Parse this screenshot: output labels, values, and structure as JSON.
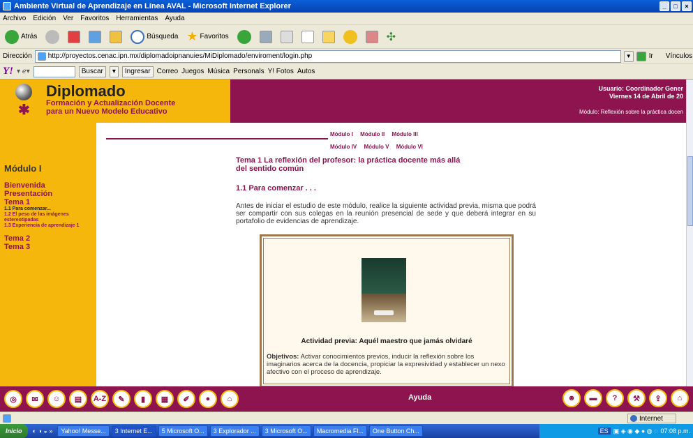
{
  "window": {
    "title": "Ambiente Virtual de Aprendizaje en Línea AVAL - Microsoft Internet Explorer"
  },
  "menu": [
    "Archivo",
    "Edición",
    "Ver",
    "Favoritos",
    "Herramientas",
    "Ayuda"
  ],
  "toolbar": {
    "back": "Atrás",
    "search": "Búsqueda",
    "favorites": "Favoritos"
  },
  "address": {
    "label": "Dirección",
    "url": "http://proyectos.cenac.ipn.mx/diplomadoipnanuies/MiDiplomado/enviroment/login.php",
    "go": "Ir",
    "links": "Vínculos"
  },
  "yahoo": {
    "search_btn": "Buscar",
    "ingresar": "Ingresar",
    "correo": "Correo",
    "juegos": "Juegos",
    "musica": "Música",
    "personals": "Personals",
    "fotos": "Y! Fotos",
    "autos": "Autos"
  },
  "header": {
    "title": "Diplomado",
    "sub1": "Formación y Actualización Docente",
    "sub2": "para un Nuevo Modelo Educativo",
    "user": "Usuario: Coordinador Gener",
    "date": "Viernes 14 de Abril de 20",
    "module": "Módulo: Reflexión sobre la práctica docen"
  },
  "sidebar": {
    "title": "Módulo I",
    "links": [
      "Bienvenida",
      "Presentación",
      "Tema 1"
    ],
    "sublinks": [
      "1.1 Para comenzar...",
      "1.2 El peso de las imágenes estereotipadas",
      "1.3 Experiencia de aprendizaje 1"
    ],
    "links2": [
      "Tema 2",
      "Tema 3"
    ]
  },
  "modnav": {
    "row1": [
      "Módulo I",
      "Módulo II",
      "Módulo III"
    ],
    "row2": [
      "Módulo IV",
      "Módulo V",
      "Módulo VI"
    ]
  },
  "content": {
    "tema_title": "Tema 1 La reflexión del profesor: la práctica docente más allá del sentido común",
    "section": "1.1 Para comenzar . . .",
    "intro": "Antes de iniciar el estudio de este módulo, realice la siguiente actividad previa, misma que podrá ser compartir con sus colegas en la reunión presencial de sede y que deberá integrar en su portafolio de evidencias de aprendizaje.",
    "activity_title": "Actividad previa: Aquél maestro que jamás olvidaré",
    "objetivos_label": "Objetivos:",
    "objetivos_text": "Activar conocimientos previos, inducir la reflexión sobre los imaginarios acerca de la docencia, propiciar la expresividad y establecer un nexo afectivo con el proceso de aprendizaje."
  },
  "footer": {
    "help": "Ayuda"
  },
  "status": {
    "zone": "Internet"
  },
  "taskbar": {
    "start": "Inicio",
    "tasks": [
      "Yahoo! Messe...",
      "3 Internet E...",
      "5 Microsoft O...",
      "3 Explorador ...",
      "3 Microsoft O...",
      "Macromedia Fl...",
      "One Button Ch..."
    ],
    "lang": "ES",
    "clock": "07:08 p.m."
  }
}
